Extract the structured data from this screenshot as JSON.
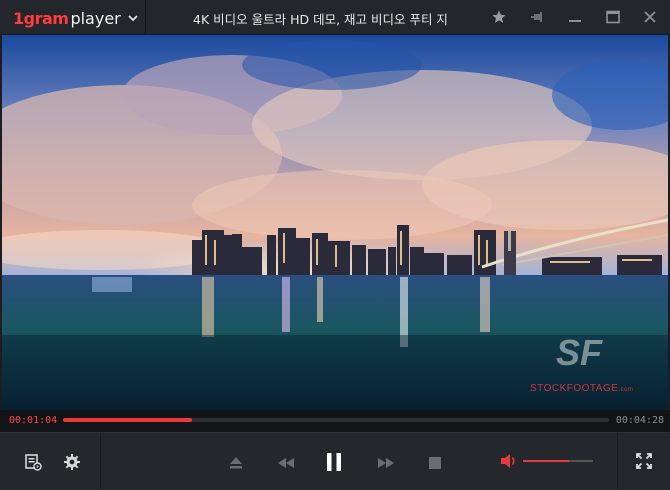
{
  "app": {
    "brand": "1gram",
    "product": "player",
    "title": "4K 비디오 울트라 HD 데모, 재고 비디오 푸티 지"
  },
  "video": {
    "watermark": "STOCKFOOTAGE",
    "watermark_suffix": ".com"
  },
  "playback": {
    "current_time": "00:01:04",
    "total_time": "00:04:28",
    "progress": 0.236,
    "state": "playing"
  },
  "volume": {
    "level": 0.65
  },
  "colors": {
    "accent": "#e83a3a",
    "titlebar": "#23262b",
    "controls": "#24272c"
  },
  "icons": {
    "menu": "chevron-down-icon",
    "bookmark": "star-icon",
    "pin": "pin-icon",
    "minimize": "minimize-icon",
    "maximize": "maximize-icon",
    "close": "close-icon",
    "playlist": "playlist-icon",
    "settings": "gear-icon",
    "eject": "eject-icon",
    "rewind": "rewind-icon",
    "pause": "pause-icon",
    "forward": "fast-forward-icon",
    "stop": "stop-icon",
    "volume": "volume-icon",
    "fullscreen": "fullscreen-icon"
  }
}
